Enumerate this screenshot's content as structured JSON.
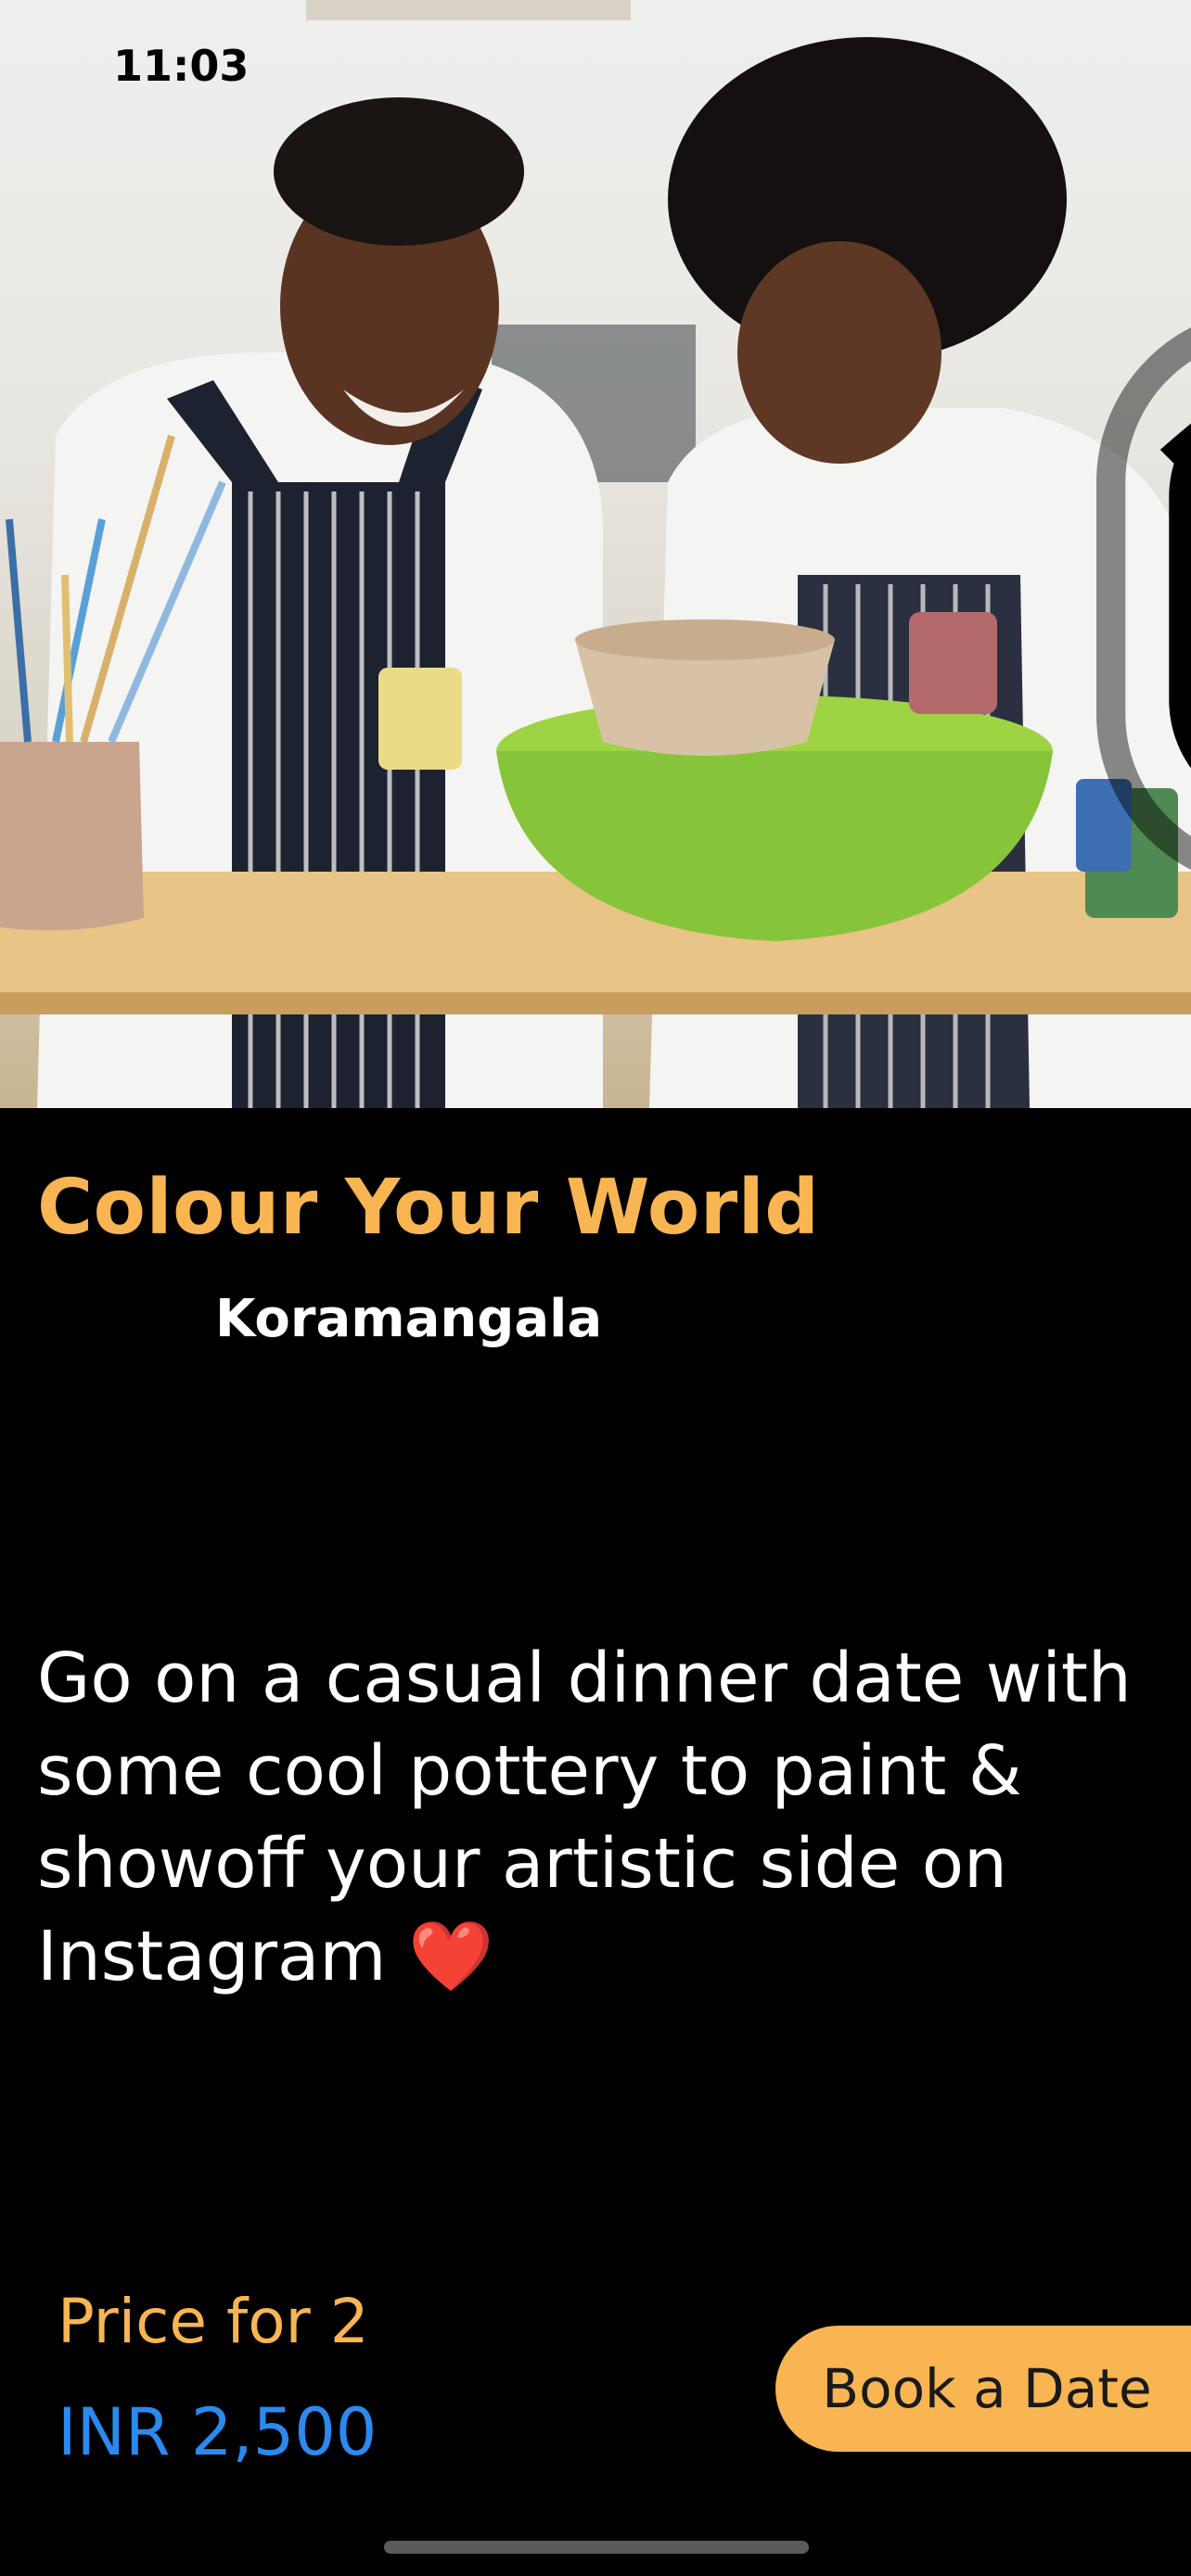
{
  "status_bar": {
    "time": "11:03",
    "icons": [
      "wifi-icon",
      "battery-icon"
    ]
  },
  "experience": {
    "title": "Colour Your World",
    "location": "Koramangala",
    "description": "Go on a casual dinner date with some cool pottery to paint & showoff your artistic side on Instagram ❤️"
  },
  "pricing": {
    "label": "Price for 2",
    "value": "INR 2,500"
  },
  "actions": {
    "book_label": "Book a Date"
  },
  "colors": {
    "accent": "#f8b552",
    "price": "#2a8af0",
    "background": "#000000"
  }
}
